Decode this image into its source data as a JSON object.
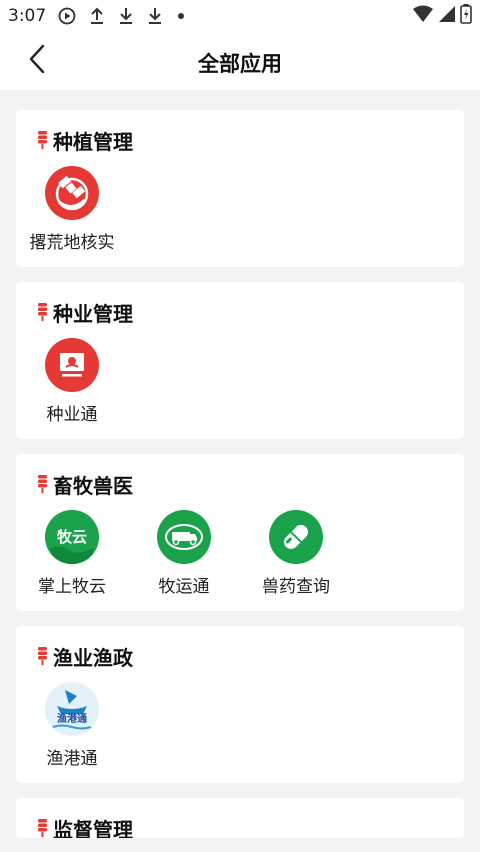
{
  "status_bar": {
    "time": "3:07",
    "icons": [
      "play-circle-icon",
      "upload-icon",
      "download-icon",
      "download-icon",
      "dot-icon",
      "wifi-icon",
      "signal-icon",
      "battery-icon"
    ]
  },
  "header": {
    "title": "全部应用",
    "back_icon": "chevron-left-icon"
  },
  "colors": {
    "accent_red": "#e53935",
    "accent_green": "#1aa34a",
    "background": "#f2f3f5",
    "card": "#ffffff"
  },
  "sections": [
    {
      "title": "种植管理",
      "apps": [
        {
          "label": "撂荒地核实",
          "icon": "satellite-globe-icon",
          "color": "#e53935"
        }
      ]
    },
    {
      "title": "种业管理",
      "apps": [
        {
          "label": "种业通",
          "icon": "monitor-seedling-icon",
          "color": "#e53935"
        }
      ]
    },
    {
      "title": "畜牧兽医",
      "apps": [
        {
          "label": "掌上牧云",
          "icon": "muyun-logo-icon",
          "color": "#1aa34a",
          "logo_text": "牧云"
        },
        {
          "label": "牧运通",
          "icon": "livestock-truck-icon",
          "color": "#1aa34a"
        },
        {
          "label": "兽药查询",
          "icon": "capsule-icon",
          "color": "#1aa34a"
        }
      ]
    },
    {
      "title": "渔业渔政",
      "apps": [
        {
          "label": "渔港通",
          "icon": "ship-logo-icon",
          "color": "#5fa8e0",
          "logo_text": "渔港通"
        }
      ]
    },
    {
      "title": "监督管理",
      "apps": []
    }
  ]
}
